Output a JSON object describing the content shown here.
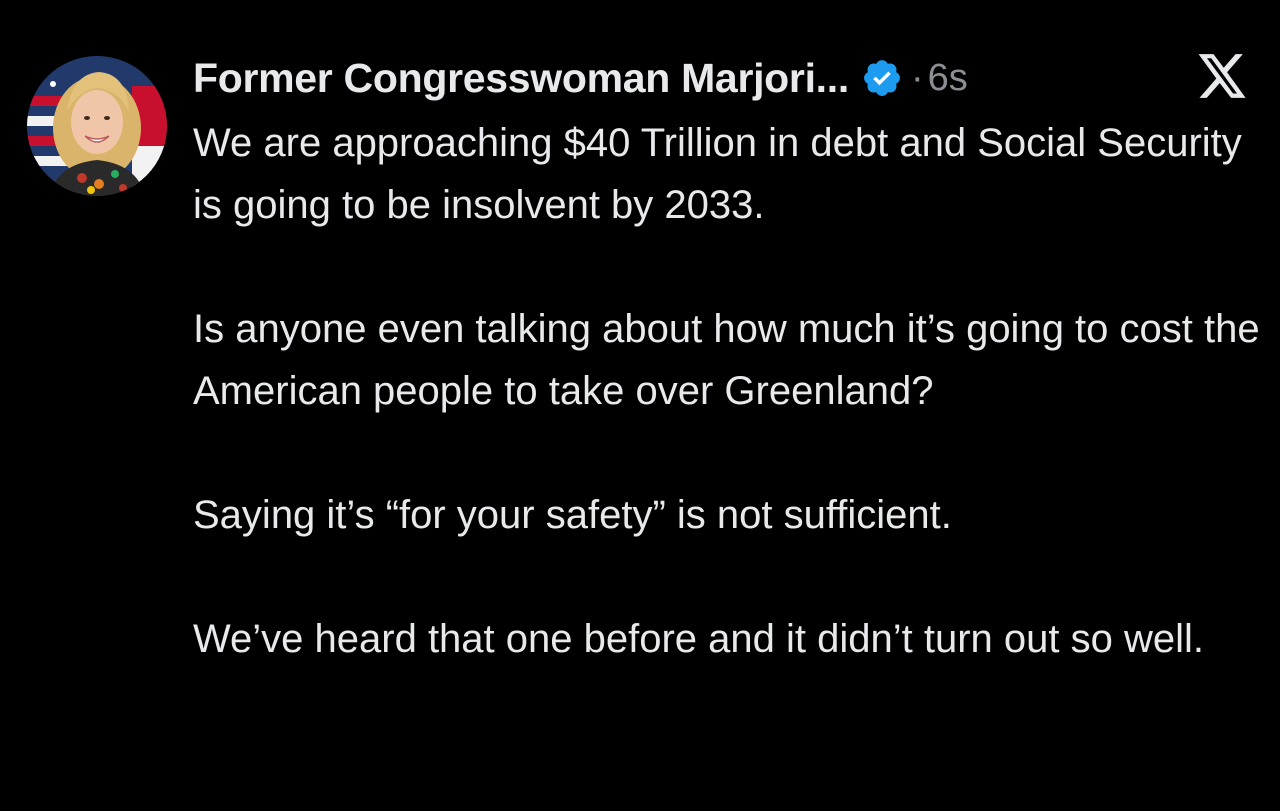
{
  "post": {
    "author": {
      "display_name": "Former Congresswoman Marjori...",
      "verified_icon": "verified-badge-icon",
      "avatar": "profile-photo"
    },
    "meta": {
      "separator": "·",
      "timestamp": "6s"
    },
    "platform_icon": "x-logo-icon",
    "paragraphs": [
      "We are approaching $40 Trillion in debt and Social Security is going to be insolvent by 2033.",
      "Is anyone even talking about how much it’s going to cost the American people to take over Greenland?",
      "Saying it’s “for your safety” is not sufficient.",
      "We’ve heard that one before and it didn’t turn out so well."
    ]
  },
  "colors": {
    "background": "#000000",
    "text": "#e7e9ea",
    "muted": "#8b8f94",
    "verified": "#1d9bf0"
  }
}
